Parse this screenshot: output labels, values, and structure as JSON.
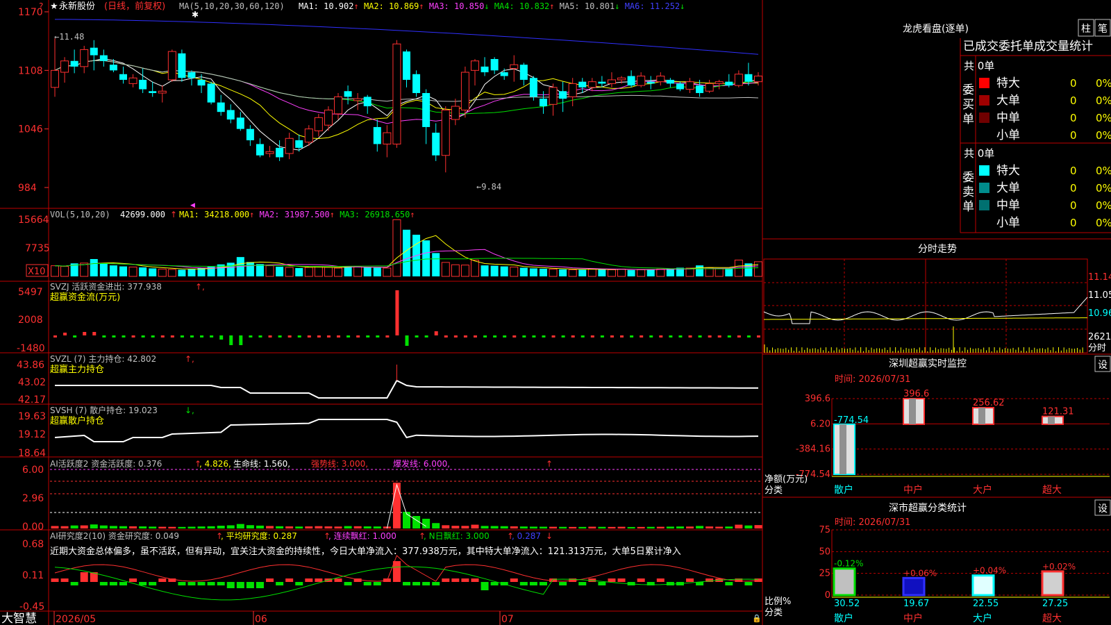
{
  "domain": "Computer-Use",
  "stock": {
    "name": "永新股份",
    "mode": "(日线，前复权)",
    "ma_label": "MA(5,10,20,30,60,120)",
    "ma": [
      {
        "label": "MA1: 10.902",
        "arrow": "↑",
        "color": "#ffffff"
      },
      {
        "label": "MA2: 10.869",
        "arrow": "↑",
        "color": "#ffff00"
      },
      {
        "label": "MA3: 10.850",
        "arrow": "↓",
        "color": "#ff40ff"
      },
      {
        "label": "MA4: 10.832",
        "arrow": "↑",
        "color": "#00e000"
      },
      {
        "label": "MA5: 10.801",
        "arrow": "↓",
        "color": "#c0c0c0"
      },
      {
        "label": "MA6: 11.252",
        "arrow": "↓",
        "color": "#4040ff"
      }
    ],
    "high_label": "←11.48",
    "low_label": "←9.84"
  },
  "price_axis": [
    "1170",
    "1108",
    "1046",
    "984"
  ],
  "vol": {
    "label": "VOL(5,10,20)",
    "value": "42699.000",
    "arrow": "↑",
    "ma": [
      {
        "label": "MA1: 34218.000",
        "arrow": "↑",
        "color": "#ffff00"
      },
      {
        "label": "MA2: 31987.500",
        "arrow": "↑",
        "color": "#ff40ff"
      },
      {
        "label": "MA3: 26918.650",
        "arrow": "↑",
        "color": "#00e000"
      }
    ],
    "axis": [
      "15664",
      "7735"
    ],
    "unit": "X10"
  },
  "svzj": {
    "line1": "SVZJ  活跃资金进出: 377.938",
    "arrow": "↑,",
    "line2": "超赢资金流(万元)",
    "axis": [
      "5497",
      "2008",
      "-1480"
    ]
  },
  "svzl": {
    "line1": "SVZL (7) 主力持仓: 42.802",
    "arrow": "↑,",
    "line2": "超赢主力持仓",
    "axis": [
      "43.86",
      "43.02",
      "42.17"
    ]
  },
  "svsh": {
    "line1": "SVSH (7) 散户持仓: 19.023",
    "arrow": "↓,",
    "line2": "超赢散户持仓",
    "axis": [
      "19.63",
      "19.12",
      "18.64"
    ]
  },
  "ai_active": {
    "label": "AI活跃度2 资金活跃度: 0.376",
    "a1": "↑",
    "v2": ", 4.826,",
    "v3": " 生命线: 1.560,",
    "v4": " 强势线: 3.000,",
    "v5": " 爆发线: 6.000,",
    "arrow": "↑",
    "axis": [
      "6.00",
      "2.96",
      "0.00"
    ]
  },
  "ai_research": {
    "label": "AI研究度2(10) 资金研究度: 0.049",
    "a1": "↑",
    "v2": ", 平均研究度: 0.287",
    "a2": "↑",
    "v3": ", 连续飘红: 1.000",
    "a3": "↑",
    "v4": ", N日飘红: 3.000",
    "a4": "↑",
    "v5": ", 0.287",
    "a5": "↓",
    "comment": "近期大资金总体偏多，虽不活跃，但有异动，宜关注大资金的持续性，今日大单净流入：377.938万元，其中特大单净流入：121.313万元，大单5日累计净入",
    "axis": [
      "0.68",
      "0.11",
      "-0.45"
    ]
  },
  "dates": [
    "2026/05",
    "06",
    "07"
  ],
  "brand": "大智慧",
  "right": {
    "lhb_title": "龙虎看盘(逐单)",
    "tab1": "柱",
    "tab2": "笔",
    "stats_header": "已成交委托单成交量统计",
    "buy": {
      "label": "委买单",
      "total": "共 0单",
      "rows": [
        {
          "name": "特大",
          "v": "0",
          "p": "0%",
          "color": "#ff0000"
        },
        {
          "name": "大单",
          "v": "0",
          "p": "0%",
          "color": "#a00000"
        },
        {
          "name": "中单",
          "v": "0",
          "p": "0%",
          "color": "#700000"
        },
        {
          "name": "小单",
          "v": "0",
          "p": "0%",
          "color": ""
        }
      ]
    },
    "sell": {
      "label": "委卖单",
      "total": "共 0单",
      "rows": [
        {
          "name": "特大",
          "v": "0",
          "p": "0%",
          "color": "#00ffff"
        },
        {
          "name": "大单",
          "v": "0",
          "p": "0%",
          "color": "#008c8c"
        },
        {
          "name": "中单",
          "v": "0",
          "p": "0%",
          "color": "#007070"
        },
        {
          "name": "小单",
          "v": "0",
          "p": "0%",
          "color": ""
        }
      ]
    },
    "fenshi": {
      "title": "分时走势",
      "axis": [
        "11.14",
        "11.05",
        "10.96"
      ],
      "vol_label": "2621",
      "vol_unit": "分时"
    },
    "monitor": {
      "title": "深圳超赢实时监控",
      "btn": "设",
      "time": "时间: 2026/07/31",
      "axis": [
        "396.6",
        "6.20",
        "-384.16",
        "-774.54"
      ],
      "bar_labels": [
        "-774.54",
        "396.6",
        "256.62",
        "121.31"
      ],
      "values": [
        -774.54,
        396.6,
        256.62,
        121.31
      ],
      "categories": [
        "散户",
        "中户",
        "大户",
        "超大"
      ],
      "ylabel": "净额(万元)",
      "xlabel": "分类"
    },
    "classify": {
      "title": "深市超赢分类统计",
      "btn": "设",
      "time": "时间: 2026/07/31",
      "axis": [
        "75",
        "50",
        "25",
        "0"
      ],
      "pct_labels": [
        "-0.12%",
        "+0.06%",
        "+0.04%",
        "+0.02%"
      ],
      "values": [
        30.52,
        19.67,
        22.55,
        27.25
      ],
      "value_labels": [
        "30.52",
        "19.67",
        "22.55",
        "27.25"
      ],
      "categories": [
        "散户",
        "中户",
        "大户",
        "超大"
      ],
      "ylabel": "比例%",
      "xlabel": "分类"
    }
  },
  "chart_data": [
    {
      "type": "candlestick",
      "title": "永新股份(日线，前复权)",
      "y_axis_ticks": [
        "1170",
        "1108",
        "1046",
        "984"
      ],
      "ylim": [
        9.7,
        11.7
      ],
      "candles": [
        [
          10.9,
          11.42,
          10.8,
          11.08
        ],
        [
          11.06,
          11.22,
          10.95,
          11.18
        ],
        [
          11.18,
          11.3,
          11.05,
          11.12
        ],
        [
          11.12,
          11.34,
          11.05,
          11.3
        ],
        [
          11.32,
          11.4,
          11.08,
          11.24
        ],
        [
          11.24,
          11.3,
          11.12,
          11.18
        ],
        [
          11.14,
          11.2,
          11.06,
          11.08
        ],
        [
          11.04,
          11.12,
          10.94,
          10.98
        ],
        [
          10.94,
          11.04,
          10.9,
          11.0
        ],
        [
          10.98,
          11.1,
          10.84,
          10.88
        ],
        [
          10.86,
          10.96,
          10.8,
          10.84
        ],
        [
          10.84,
          10.92,
          10.74,
          10.86
        ],
        [
          10.98,
          11.3,
          10.96,
          11.28
        ],
        [
          11.26,
          11.3,
          10.96,
          11.0
        ],
        [
          11.06,
          11.08,
          10.92,
          11.0
        ],
        [
          10.98,
          11.04,
          10.84,
          10.92
        ],
        [
          10.94,
          10.96,
          10.72,
          10.74
        ],
        [
          10.74,
          10.82,
          10.6,
          10.64
        ],
        [
          10.66,
          10.72,
          10.52,
          10.56
        ],
        [
          10.58,
          10.64,
          10.44,
          10.46
        ],
        [
          10.46,
          10.5,
          10.28,
          10.34
        ],
        [
          10.3,
          10.36,
          10.16,
          10.18
        ],
        [
          10.2,
          10.28,
          10.16,
          10.22
        ],
        [
          10.26,
          10.34,
          10.12,
          10.16
        ],
        [
          10.2,
          10.42,
          10.14,
          10.36
        ],
        [
          10.34,
          10.4,
          10.22,
          10.26
        ],
        [
          10.32,
          10.5,
          10.28,
          10.46
        ],
        [
          10.44,
          10.62,
          10.38,
          10.58
        ],
        [
          10.5,
          10.7,
          10.44,
          10.66
        ],
        [
          10.62,
          10.84,
          10.56,
          10.8
        ],
        [
          10.86,
          10.92,
          10.72,
          10.8
        ],
        [
          10.76,
          10.84,
          10.66,
          10.78
        ],
        [
          10.8,
          10.82,
          10.62,
          10.7
        ],
        [
          10.48,
          10.56,
          10.22,
          10.3
        ],
        [
          10.3,
          10.5,
          10.16,
          10.42
        ],
        [
          10.3,
          11.4,
          10.26,
          11.36
        ],
        [
          11.28,
          11.3,
          10.9,
          10.98
        ],
        [
          11.04,
          11.08,
          10.8,
          10.84
        ],
        [
          10.84,
          10.88,
          10.3,
          10.48
        ],
        [
          10.42,
          10.52,
          10.12,
          10.18
        ],
        [
          10.18,
          10.7,
          10.0,
          10.66
        ],
        [
          10.56,
          10.78,
          10.5,
          10.7
        ],
        [
          10.66,
          11.12,
          10.58,
          11.06
        ],
        [
          11.08,
          11.2,
          10.92,
          11.18
        ],
        [
          11.12,
          11.22,
          11.02,
          11.06
        ],
        [
          11.2,
          11.22,
          11.04,
          11.08
        ],
        [
          11.06,
          11.1,
          10.98,
          11.02
        ],
        [
          11.1,
          11.24,
          10.96,
          11.14
        ],
        [
          11.14,
          11.16,
          10.92,
          10.98
        ],
        [
          11.0,
          11.02,
          10.76,
          10.8
        ],
        [
          10.78,
          10.86,
          10.62,
          10.7
        ],
        [
          10.72,
          10.94,
          10.6,
          10.9
        ],
        [
          10.86,
          10.96,
          10.64,
          10.78
        ],
        [
          10.8,
          11.0,
          10.7,
          10.94
        ],
        [
          10.96,
          11.0,
          10.84,
          10.9
        ],
        [
          10.9,
          11.0,
          10.86,
          10.96
        ],
        [
          10.96,
          11.02,
          10.9,
          10.94
        ],
        [
          10.94,
          11.06,
          10.9,
          10.98
        ],
        [
          10.98,
          11.02,
          10.94,
          11.0
        ],
        [
          11.02,
          11.08,
          10.9,
          10.92
        ],
        [
          10.92,
          11.06,
          10.9,
          11.02
        ],
        [
          10.96,
          11.02,
          10.88,
          10.94
        ],
        [
          10.96,
          11.06,
          10.92,
          11.02
        ],
        [
          10.98,
          11.0,
          10.9,
          10.94
        ],
        [
          10.94,
          10.96,
          10.86,
          10.88
        ],
        [
          10.88,
          11.0,
          10.84,
          10.96
        ],
        [
          10.92,
          10.98,
          10.8,
          10.84
        ],
        [
          10.86,
          10.98,
          10.84,
          10.94
        ],
        [
          10.94,
          10.98,
          10.88,
          10.96
        ],
        [
          10.96,
          11.04,
          10.9,
          10.92
        ],
        [
          10.92,
          11.08,
          10.9,
          11.04
        ],
        [
          11.04,
          11.16,
          10.92,
          10.96
        ],
        [
          10.96,
          11.06,
          10.92,
          11.02
        ]
      ]
    },
    {
      "type": "bar",
      "title": "VOL(5,10,20)",
      "y_axis_ticks": [
        "15664",
        "7735"
      ],
      "unit": "X10",
      "values": [
        3200,
        3000,
        3900,
        4000,
        5200,
        3900,
        3300,
        3000,
        2800,
        2700,
        2400,
        2200,
        2100,
        2000,
        2300,
        2600,
        2900,
        3600,
        4100,
        5800,
        4300,
        3700,
        3200,
        2900,
        2700,
        2500,
        2700,
        3000,
        2700,
        2500,
        3100,
        2900,
        2700,
        2600,
        2500,
        17000,
        14000,
        12500,
        10800,
        7000,
        4200,
        3500,
        3400,
        4900,
        3300,
        3200,
        3000,
        2800,
        2600,
        2400,
        2300,
        2200,
        2100,
        2000,
        2000,
        2300,
        2100,
        2000,
        2200,
        1900,
        2000,
        2100,
        2200,
        2400,
        2600,
        2500,
        3300,
        2600,
        2300,
        2500,
        4900,
        3900,
        4400
      ]
    },
    {
      "type": "line",
      "title": "分时走势",
      "y_axis_ticks": [
        "11.14",
        "11.05",
        "10.96"
      ]
    },
    {
      "type": "bar",
      "title": "深圳超赢实时监控",
      "categories": [
        "散户",
        "中户",
        "大户",
        "超大"
      ],
      "values": [
        -774.54,
        396.6,
        256.62,
        121.31
      ],
      "ylabel": "净额(万元)",
      "xlabel": "分类"
    },
    {
      "type": "bar",
      "title": "深市超赢分类统计",
      "categories": [
        "散户",
        "中户",
        "大户",
        "超大"
      ],
      "values": [
        30.52,
        19.67,
        22.55,
        27.25
      ],
      "ylabel": "比例%",
      "xlabel": "分类",
      "ylim": [
        0,
        75
      ]
    }
  ]
}
